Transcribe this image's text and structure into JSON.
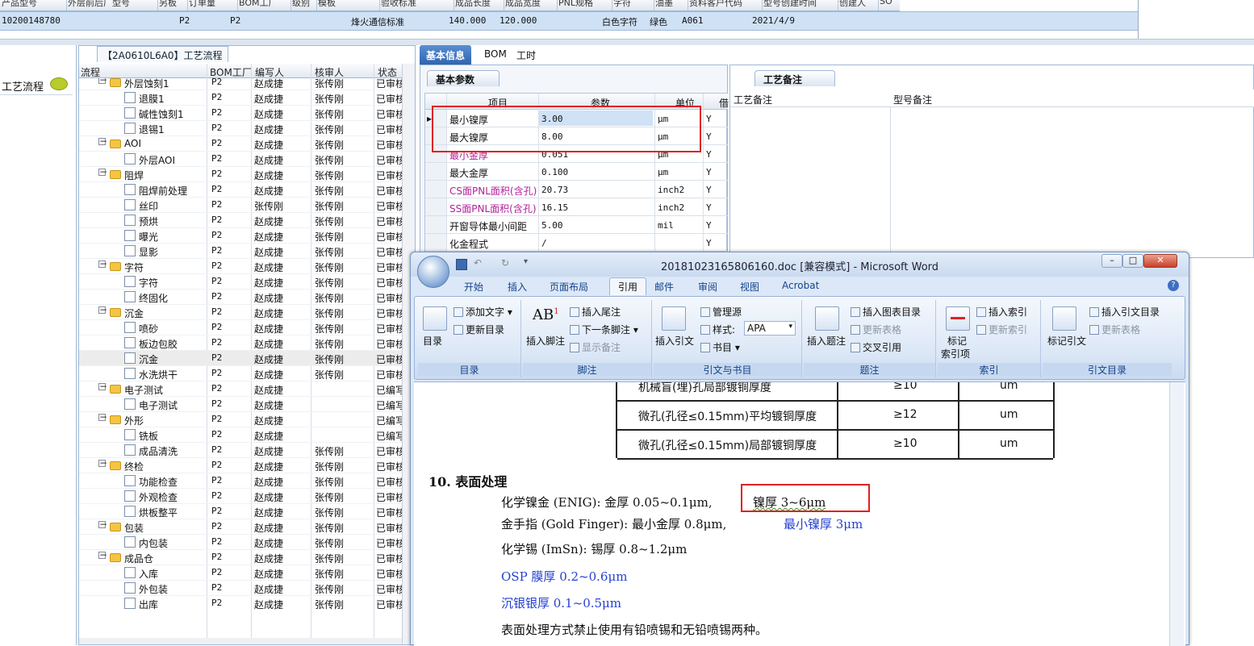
{
  "top_grid": {
    "headers": [
      "产品型号",
      "外层前后厂型号",
      "另板",
      "订单量",
      "BOM工厂",
      "级别",
      "模板",
      "验收标准",
      "成品长度",
      "成品宽度",
      "PNL规格",
      "字符",
      "油墨",
      "资料客户代码",
      "型号创建时间",
      "创建人",
      "SO"
    ],
    "row": {
      "id": "10200148780",
      "col1": "P2",
      "col2": "P2",
      "standard": "烽火通信标准",
      "length": "140.000",
      "width": "120.000",
      "char": "白色字符",
      "ink": "绿色",
      "code": "A061",
      "date": "2021/4/9"
    }
  },
  "left_strip": {
    "label": "工艺流程",
    "icon": "speech-bubble-icon"
  },
  "process_panel": {
    "title": "【2A0610L6A0】工艺流程",
    "columns": [
      "流程",
      "BOM工厂",
      "编写人",
      "核审人",
      "状态"
    ],
    "rows": [
      {
        "level": 1,
        "type": "folder",
        "name": "外层蚀刻1",
        "bom": "P2",
        "writer": "赵成捷",
        "reviewer": "张传刚",
        "status": "已审核"
      },
      {
        "level": 2,
        "type": "doc",
        "name": "退膜1",
        "bom": "P2",
        "writer": "赵成捷",
        "reviewer": "张传刚",
        "status": "已审核"
      },
      {
        "level": 2,
        "type": "doc",
        "name": "碱性蚀刻1",
        "bom": "P2",
        "writer": "赵成捷",
        "reviewer": "张传刚",
        "status": "已审核"
      },
      {
        "level": 2,
        "type": "doc",
        "name": "退锡1",
        "bom": "P2",
        "writer": "赵成捷",
        "reviewer": "张传刚",
        "status": "已审核"
      },
      {
        "level": 1,
        "type": "folder",
        "name": "AOI",
        "bom": "P2",
        "writer": "赵成捷",
        "reviewer": "张传刚",
        "status": "已审核"
      },
      {
        "level": 2,
        "type": "doc",
        "name": "外层AOI",
        "bom": "P2",
        "writer": "赵成捷",
        "reviewer": "张传刚",
        "status": "已审核"
      },
      {
        "level": 1,
        "type": "folder",
        "name": "阻焊",
        "bom": "P2",
        "writer": "赵成捷",
        "reviewer": "张传刚",
        "status": "已审核"
      },
      {
        "level": 2,
        "type": "doc",
        "name": "阻焊前处理",
        "bom": "P2",
        "writer": "赵成捷",
        "reviewer": "张传刚",
        "status": "已审核"
      },
      {
        "level": 2,
        "type": "doc",
        "name": "丝印",
        "bom": "P2",
        "writer": "张传刚",
        "reviewer": "张传刚",
        "status": "已审核"
      },
      {
        "level": 2,
        "type": "doc",
        "name": "预烘",
        "bom": "P2",
        "writer": "赵成捷",
        "reviewer": "张传刚",
        "status": "已审核"
      },
      {
        "level": 2,
        "type": "doc",
        "name": "曝光",
        "bom": "P2",
        "writer": "赵成捷",
        "reviewer": "张传刚",
        "status": "已审核"
      },
      {
        "level": 2,
        "type": "doc",
        "name": "显影",
        "bom": "P2",
        "writer": "赵成捷",
        "reviewer": "张传刚",
        "status": "已审核"
      },
      {
        "level": 1,
        "type": "folder",
        "name": "字符",
        "bom": "P2",
        "writer": "赵成捷",
        "reviewer": "张传刚",
        "status": "已审核"
      },
      {
        "level": 2,
        "type": "doc",
        "name": "字符",
        "bom": "P2",
        "writer": "赵成捷",
        "reviewer": "张传刚",
        "status": "已审核"
      },
      {
        "level": 2,
        "type": "doc",
        "name": "终固化",
        "bom": "P2",
        "writer": "赵成捷",
        "reviewer": "张传刚",
        "status": "已审核"
      },
      {
        "level": 1,
        "type": "folder",
        "name": "沉金",
        "bom": "P2",
        "writer": "赵成捷",
        "reviewer": "张传刚",
        "status": "已审核"
      },
      {
        "level": 2,
        "type": "doc",
        "name": "喷砂",
        "bom": "P2",
        "writer": "赵成捷",
        "reviewer": "张传刚",
        "status": "已审核"
      },
      {
        "level": 2,
        "type": "doc",
        "name": "板边包胶",
        "bom": "P2",
        "writer": "赵成捷",
        "reviewer": "张传刚",
        "status": "已审核"
      },
      {
        "level": 2,
        "type": "doc",
        "name": "沉金",
        "bom": "P2",
        "writer": "赵成捷",
        "reviewer": "张传刚",
        "status": "已审核",
        "selected": true
      },
      {
        "level": 2,
        "type": "doc",
        "name": "水洗烘干",
        "bom": "P2",
        "writer": "赵成捷",
        "reviewer": "张传刚",
        "status": "已审核"
      },
      {
        "level": 1,
        "type": "folder",
        "name": "电子测试",
        "bom": "P2",
        "writer": "赵成捷",
        "reviewer": "",
        "status": "已编写"
      },
      {
        "level": 2,
        "type": "doc",
        "name": "电子测试",
        "bom": "P2",
        "writer": "赵成捷",
        "reviewer": "",
        "status": "已编写"
      },
      {
        "level": 1,
        "type": "folder",
        "name": "外形",
        "bom": "P2",
        "writer": "赵成捷",
        "reviewer": "",
        "status": "已编写"
      },
      {
        "level": 2,
        "type": "doc",
        "name": "铣板",
        "bom": "P2",
        "writer": "赵成捷",
        "reviewer": "",
        "status": "已编写"
      },
      {
        "level": 2,
        "type": "doc",
        "name": "成品清洗",
        "bom": "P2",
        "writer": "赵成捷",
        "reviewer": "张传刚",
        "status": "已审核"
      },
      {
        "level": 1,
        "type": "folder",
        "name": "终检",
        "bom": "P2",
        "writer": "赵成捷",
        "reviewer": "张传刚",
        "status": "已审核"
      },
      {
        "level": 2,
        "type": "doc",
        "name": "功能检查",
        "bom": "P2",
        "writer": "赵成捷",
        "reviewer": "张传刚",
        "status": "已审核"
      },
      {
        "level": 2,
        "type": "doc",
        "name": "外观检查",
        "bom": "P2",
        "writer": "赵成捷",
        "reviewer": "张传刚",
        "status": "已审核"
      },
      {
        "level": 2,
        "type": "doc",
        "name": "烘板整平",
        "bom": "P2",
        "writer": "赵成捷",
        "reviewer": "张传刚",
        "status": "已审核"
      },
      {
        "level": 1,
        "type": "folder",
        "name": "包装",
        "bom": "P2",
        "writer": "赵成捷",
        "reviewer": "张传刚",
        "status": "已审核"
      },
      {
        "level": 2,
        "type": "doc",
        "name": "内包装",
        "bom": "P2",
        "writer": "赵成捷",
        "reviewer": "张传刚",
        "status": "已审核"
      },
      {
        "level": 1,
        "type": "folder",
        "name": "成品仓",
        "bom": "P2",
        "writer": "赵成捷",
        "reviewer": "张传刚",
        "status": "已审核"
      },
      {
        "level": 2,
        "type": "doc",
        "name": "入库",
        "bom": "P2",
        "writer": "赵成捷",
        "reviewer": "张传刚",
        "status": "已审核"
      },
      {
        "level": 2,
        "type": "doc",
        "name": "外包装",
        "bom": "P2",
        "writer": "赵成捷",
        "reviewer": "张传刚",
        "status": "已审核"
      },
      {
        "level": 2,
        "type": "doc",
        "name": "出库",
        "bom": "P2",
        "writer": "赵成捷",
        "reviewer": "张传刚",
        "status": "已审核"
      }
    ]
  },
  "center_tabs": [
    "基本信息",
    "BOM",
    "工时"
  ],
  "basic_params": {
    "section": "基本参数",
    "columns": [
      "项目",
      "参数",
      "单位",
      "借"
    ],
    "rows": [
      {
        "item": "最小镍厚",
        "value": "3.00",
        "unit": "μm",
        "flag": "Y",
        "color": "#111111"
      },
      {
        "item": "最大镍厚",
        "value": "8.00",
        "unit": "μm",
        "flag": "Y",
        "color": "#111111"
      },
      {
        "item": "最小金厚",
        "value": "0.051",
        "unit": "μm",
        "flag": "Y",
        "color": "#b0209a"
      },
      {
        "item": "最大金厚",
        "value": "0.100",
        "unit": "μm",
        "flag": "Y",
        "color": "#111111"
      },
      {
        "item": "CS面PNL面积(含孔)",
        "value": "20.73",
        "unit": "inch2",
        "flag": "Y",
        "color": "#b0209a"
      },
      {
        "item": "SS面PNL面积(含孔)",
        "value": "16.15",
        "unit": "inch2",
        "flag": "Y",
        "color": "#b0209a"
      },
      {
        "item": "开窗导体最小间距",
        "value": "5.00",
        "unit": "mil",
        "flag": "Y",
        "color": "#111111"
      },
      {
        "item": "化金程式",
        "value": "/",
        "unit": "",
        "flag": "Y",
        "color": "#111111"
      }
    ]
  },
  "remark_panel": {
    "tab": "工艺备注",
    "columns": [
      "工艺备注",
      "型号备注"
    ]
  },
  "word": {
    "title": "20181023165806160.doc [兼容模式] - Microsoft Word",
    "tabs": [
      "开始",
      "插入",
      "页面布局",
      "引用",
      "邮件",
      "审阅",
      "视图",
      "Acrobat"
    ],
    "active_tab": "引用",
    "groups": {
      "toc": {
        "label": "目录",
        "big": "目录",
        "items": [
          "添加文字",
          "更新目录"
        ]
      },
      "footnote": {
        "label": "脚注",
        "big": "插入脚注",
        "items": [
          "插入尾注",
          "下一条脚注",
          "显示备注"
        ]
      },
      "citation": {
        "label": "引文与书目",
        "big": "插入引文",
        "items": [
          "管理源",
          "样式:",
          "书目"
        ],
        "style_value": "APA"
      },
      "caption": {
        "label": "题注",
        "big": "插入题注",
        "items": [
          "插入图表目录",
          "更新表格",
          "交叉引用"
        ]
      },
      "index": {
        "label": "索引",
        "big1": "标记",
        "big2": "索引项",
        "items": [
          "插入索引",
          "更新索引"
        ]
      },
      "toa": {
        "label": "引文目录",
        "big": "标记引文",
        "items": [
          "插入引文目录",
          "更新表格"
        ]
      }
    },
    "doc_table": [
      {
        "item": "机械盲(埋)孔局部镀铜厚度",
        "value": "≥10",
        "unit": "um"
      },
      {
        "item": "微孔(孔径≤0.15mm)平均镀铜厚度",
        "value": "≥12",
        "unit": "um"
      },
      {
        "item": "微孔(孔径≤0.15mm)局部镀铜厚度",
        "value": "≥10",
        "unit": "um"
      }
    ],
    "heading": "10. 表面处理",
    "lines": {
      "enig_a": "化学镍金 (ENIG): 金厚 0.05~0.1μm,",
      "enig_b": "镍厚 3~6μm",
      "gold_a": "金手指 (Gold Finger): 最小金厚 0.8μm,",
      "gold_b": "最小镍厚 3μm",
      "tin": "化学锡 (ImSn): 锡厚 0.8~1.2μm",
      "osp": "OSP 膜厚 0.2~0.6μm",
      "silver": "沉银银厚 0.1~0.5μm",
      "note": "表面处理方式禁止使用有铅喷锡和无铅喷锡两种。"
    }
  }
}
